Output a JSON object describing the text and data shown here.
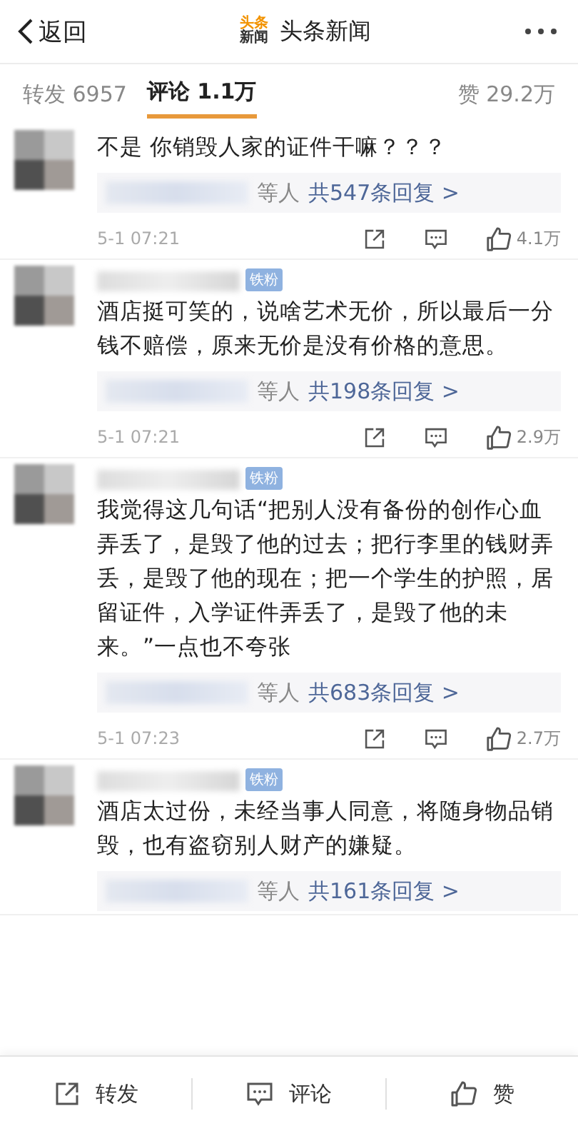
{
  "header": {
    "back": "返回",
    "logo_lines": [
      "头条",
      "新闻"
    ],
    "title": "头条新闻"
  },
  "tabs": [
    {
      "label": "转发",
      "count": "6957",
      "selected": false
    },
    {
      "label": "评论",
      "count": "1.1万",
      "selected": true
    },
    {
      "label": "赞",
      "count": "29.2万",
      "selected": false
    }
  ],
  "comments": [
    {
      "text": "不是 你销毁人家的证件干嘛？？？",
      "replies_suffix": "等人",
      "replies_link": "共547条回复 >",
      "time": "5-1 07:21",
      "likes": "4.1万"
    },
    {
      "badge": "铁粉",
      "text": "酒店挺可笑的，说啥艺术无价，所以最后一分钱不赔偿，原来无价是没有价格的意思。",
      "replies_suffix": "等人",
      "replies_link": "共198条回复 >",
      "time": "5-1 07:21",
      "likes": "2.9万"
    },
    {
      "badge": "铁粉",
      "text": "我觉得这几句话“把别人没有备份的创作心血弄丢了，是毁了他的过去；把行李里的钱财弄丢，是毁了他的现在；把一个学生的护照，居留证件，入学证件弄丢了，是毁了他的未来。”一点也不夸张",
      "replies_suffix": "等人",
      "replies_link": "共683条回复 >",
      "time": "5-1 07:23",
      "likes": "2.7万"
    },
    {
      "badge": "铁粉",
      "text": "酒店太过份，未经当事人同意，将随身物品销毁，也有盗窃别人财产的嫌疑。",
      "replies_suffix": "等人",
      "replies_link": "共161条回复 >"
    }
  ],
  "bottom_bar": [
    {
      "kind": "share",
      "label": "转发"
    },
    {
      "kind": "comment",
      "label": "评论"
    },
    {
      "kind": "like",
      "label": "赞"
    }
  ]
}
